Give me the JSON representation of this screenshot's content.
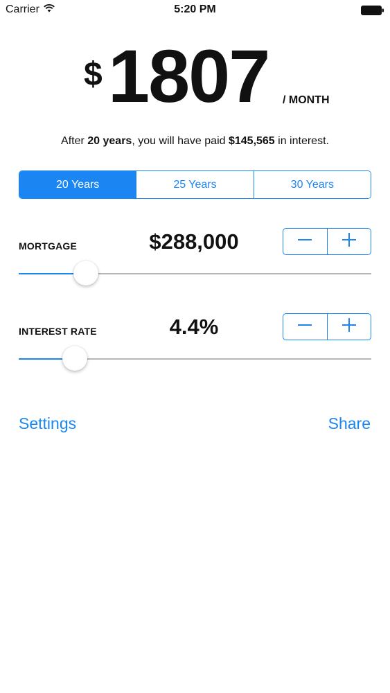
{
  "status_bar": {
    "carrier": "Carrier",
    "time": "5:20 PM"
  },
  "payment": {
    "currency_symbol": "$",
    "amount": "1807",
    "period": "/ MONTH"
  },
  "summary": {
    "prefix": "After ",
    "term": "20 years",
    "middle": ", you will have paid ",
    "interest_total": "$145,565",
    "suffix": " in interest."
  },
  "term_options": {
    "selected_index": 0,
    "items": [
      "20 Years",
      "25 Years",
      "30 Years"
    ]
  },
  "mortgage": {
    "label": "MORTGAGE",
    "value": "$288,000",
    "slider_fraction": 0.19
  },
  "interest_rate": {
    "label": "INTEREST RATE",
    "value": "4.4%",
    "slider_fraction": 0.16
  },
  "stepper": {
    "decrement_icon": "minus-icon",
    "increment_icon": "plus-icon"
  },
  "footer": {
    "settings_label": "Settings",
    "share_label": "Share"
  },
  "colors": {
    "accent": "#1b86f2",
    "track": "#b8b8b8",
    "text": "#111111",
    "background": "#ffffff"
  }
}
